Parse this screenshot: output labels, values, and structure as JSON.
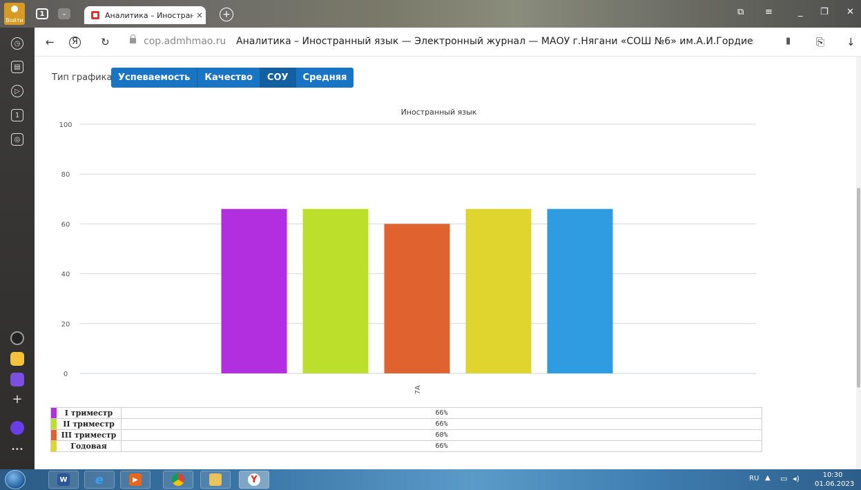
{
  "browser": {
    "login_label": "Войти",
    "tab_count": "1",
    "tab_title": "Аналитика – Иностранн",
    "tab_close": "×",
    "new_tab": "+",
    "url_host": "cop.admhmao.ru",
    "url_title": "Аналитика – Иностранный язык  — Электронный журнал — МАОУ г.Нягани «СОШ №6» им.А.И.Гордиенко —..."
  },
  "page": {
    "chart_type_label": "Тип графика:",
    "chart_type_buttons": [
      {
        "label": "Успеваемость",
        "active": false
      },
      {
        "label": "Качество",
        "active": false
      },
      {
        "label": "СОУ",
        "active": true
      },
      {
        "label": "Средняя",
        "active": false
      }
    ]
  },
  "chart_data": {
    "type": "bar",
    "title": "Иностранный язык",
    "categories": [
      "7А"
    ],
    "ylim": [
      0,
      100
    ],
    "yticks": [
      0,
      20,
      40,
      60,
      80,
      100
    ],
    "grid": true,
    "series": [
      {
        "name": "I триместр",
        "values": [
          66
        ],
        "label": "66%",
        "color": "#b22fe0"
      },
      {
        "name": "II триместр",
        "values": [
          66
        ],
        "label": "66%",
        "color": "#bcdf2c"
      },
      {
        "name": "III триместр",
        "values": [
          60
        ],
        "label": "60%",
        "color": "#e0622e"
      },
      {
        "name": "Годовая",
        "values": [
          66
        ],
        "label": "66%",
        "color": "#e0d42e"
      },
      {
        "name": "",
        "values": [
          66
        ],
        "label": "",
        "color": "#2f9be0"
      }
    ]
  },
  "taskbar": {
    "lang": "RU",
    "time": "10:30",
    "date": "01.06.2023"
  }
}
